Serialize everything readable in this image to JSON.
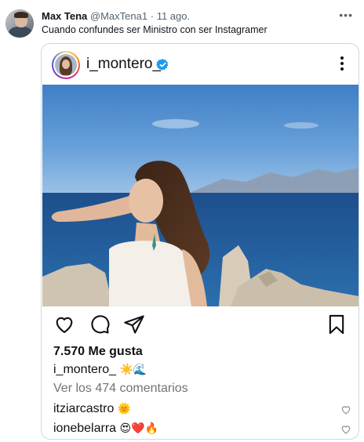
{
  "tweet": {
    "author_name": "Max Tena",
    "author_handle": "@MaxTena1",
    "separator": "·",
    "date": "11 ago.",
    "text": "Cuando confundes ser Ministro con ser Instagramer",
    "more_icon": "more-horizontal-icon"
  },
  "instagram_post": {
    "username": "i_montero_",
    "verified": true,
    "likes_text": "7.570 Me gusta",
    "caption": {
      "user": "i_montero_",
      "emojis": "☀️🌊"
    },
    "view_comments": "Ver los 474 comentarios",
    "comments": [
      {
        "user": "itziarcastro",
        "emojis": "🌞"
      },
      {
        "user": "ionebelarra",
        "emojis": "😍❤️🔥"
      }
    ],
    "action_icons": [
      "heart-icon",
      "comment-icon",
      "share-icon",
      "bookmark-icon"
    ]
  },
  "colors": {
    "text_primary": "#0f1419",
    "text_secondary": "#536471",
    "card_border": "#cfd9de",
    "verified_blue": "#1d9bf0",
    "muted_gray": "#737373"
  }
}
